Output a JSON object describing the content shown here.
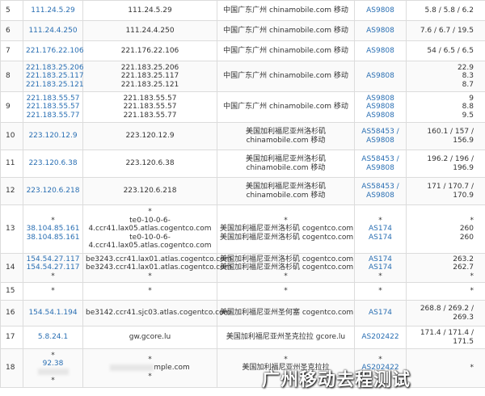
{
  "rows": [
    {
      "hop": "5",
      "ips": [
        "111.24.5.29"
      ],
      "hosts": [
        "111.24.5.29"
      ],
      "geo": [
        "中国广东广州 chinamobile.com 移动"
      ],
      "as": [
        "AS9808"
      ],
      "rtt": [
        "5.8 / 5.8 / 6.2"
      ]
    },
    {
      "hop": "6",
      "ips": [
        "111.24.4.250"
      ],
      "hosts": [
        "111.24.4.250"
      ],
      "geo": [
        "中国广东广州 chinamobile.com 移动"
      ],
      "as": [
        "AS9808"
      ],
      "rtt": [
        "7.6 / 6.7 / 19.5"
      ]
    },
    {
      "hop": "7",
      "ips": [
        "221.176.22.106"
      ],
      "hosts": [
        "221.176.22.106"
      ],
      "geo": [
        "中国广东广州 chinamobile.com 移动"
      ],
      "as": [
        "AS9808"
      ],
      "rtt": [
        "54 / 6.5 / 6.5"
      ]
    },
    {
      "hop": "8",
      "ips": [
        "221.183.25.206",
        "221.183.25.117",
        "221.183.25.121"
      ],
      "hosts": [
        "221.183.25.206",
        "221.183.25.117",
        "221.183.25.121"
      ],
      "geo": [
        "中国广东广州 chinamobile.com 移动"
      ],
      "as": [
        "AS9808"
      ],
      "rtt": [
        "22.9",
        "8.3",
        "8.7"
      ]
    },
    {
      "hop": "9",
      "ips": [
        "221.183.55.57",
        "221.183.55.57",
        "221.183.55.77"
      ],
      "hosts": [
        "221.183.55.57",
        "221.183.55.57",
        "221.183.55.77"
      ],
      "geo": [
        "中国广东广州 chinamobile.com 移动"
      ],
      "as": [
        "AS9808",
        "AS9808",
        "AS9808"
      ],
      "rtt": [
        "9",
        "8.8",
        "9.5"
      ]
    },
    {
      "hop": "10",
      "ips": [
        "223.120.12.9"
      ],
      "hosts": [
        "223.120.12.9"
      ],
      "geo": [
        "美国加利福尼亚州洛杉矶",
        "chinamobile.com 移动"
      ],
      "as": [
        "AS58453 /",
        "AS9808"
      ],
      "rtt": [
        "160.1 / 157 /",
        "156.9"
      ]
    },
    {
      "hop": "11",
      "ips": [
        "223.120.6.38"
      ],
      "hosts": [
        "223.120.6.38"
      ],
      "geo": [
        "美国加利福尼亚州洛杉矶",
        "chinamobile.com 移动"
      ],
      "as": [
        "AS58453 /",
        "AS9808"
      ],
      "rtt": [
        "196.2 / 196 /",
        "196.9"
      ]
    },
    {
      "hop": "12",
      "ips": [
        "223.120.6.218"
      ],
      "hosts": [
        "223.120.6.218"
      ],
      "geo": [
        "美国加利福尼亚州洛杉矶",
        "chinamobile.com 移动"
      ],
      "as": [
        "AS58453 /",
        "AS9808"
      ],
      "rtt": [
        "171 / 170.7 /",
        "170.9"
      ]
    },
    {
      "hop": "13",
      "ips": [
        "*",
        "38.104.85.161",
        "38.104.85.161"
      ],
      "hosts": [
        "*",
        "te0-10-0-6-",
        "4.ccr41.lax05.atlas.cogentco.com",
        "te0-10-0-6-",
        "4.ccr41.lax05.atlas.cogentco.com"
      ],
      "geo": [
        "*",
        "美国加利福尼亚州洛杉矶 cogentco.com",
        "美国加利福尼亚州洛杉矶 cogentco.com"
      ],
      "as": [
        "*",
        "AS174",
        "AS174"
      ],
      "rtt": [
        "*",
        "260",
        "260"
      ]
    },
    {
      "hop": "14",
      "ips": [
        "154.54.27.117",
        "154.54.27.117",
        "*"
      ],
      "hosts": [
        "be3243.ccr41.lax01.atlas.cogentco.com",
        "be3243.ccr41.lax01.atlas.cogentco.com",
        "*"
      ],
      "geo": [
        "美国加利福尼亚州洛杉矶 cogentco.com",
        "美国加利福尼亚州洛杉矶 cogentco.com",
        "*"
      ],
      "as": [
        "AS174",
        "AS174",
        "*"
      ],
      "rtt": [
        "263.2",
        "262.7",
        "*"
      ]
    },
    {
      "hop": "15",
      "ips": [
        "*"
      ],
      "hosts": [
        "*"
      ],
      "geo": [
        "*"
      ],
      "as": [
        "*"
      ],
      "rtt": [
        "*"
      ]
    },
    {
      "hop": "16",
      "ips": [
        "154.54.1.194"
      ],
      "hosts": [
        "be3142.ccr41.sjc03.atlas.cogentco.com"
      ],
      "geo": [
        "美国加利福尼亚州圣何塞 cogentco.com"
      ],
      "as": [
        "AS174"
      ],
      "rtt": [
        "268.8 / 269.2 /",
        "269.3"
      ]
    },
    {
      "hop": "17",
      "ips": [
        "5.8.24.1"
      ],
      "hosts": [
        "gw.gcore.lu"
      ],
      "geo": [
        "美国加利福尼亚州圣克拉拉 gcore.lu"
      ],
      "as": [
        "AS202422"
      ],
      "rtt": [
        "171.4 / 171.4 /",
        "171.5"
      ]
    },
    {
      "hop": "18",
      "ips": [
        "*",
        "92.38",
        "*"
      ],
      "hosts": [
        "*",
        "mple.com",
        "*"
      ],
      "geo": [
        "*",
        "美国加利福尼亚州圣克拉拉",
        "*"
      ],
      "as": [
        "*",
        "AS202422",
        "*"
      ],
      "rtt": [
        "*",
        "",
        ""
      ]
    }
  ],
  "watermark": "广州移动去程测试"
}
